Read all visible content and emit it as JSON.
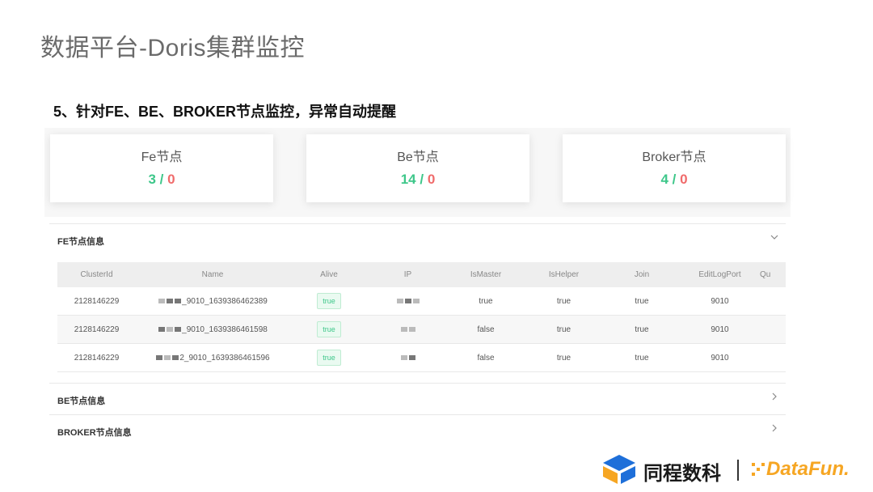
{
  "slide": {
    "title": "数据平台-Doris集群监控",
    "subtitle": "5、针对FE、BE、BROKER节点监控，异常自动提醒"
  },
  "stats": [
    {
      "title": "Fe节点",
      "ok": "3",
      "sep": " / ",
      "bad": "0"
    },
    {
      "title": "Be节点",
      "ok": "14",
      "sep": " / ",
      "bad": "0"
    },
    {
      "title": "Broker节点",
      "ok": "4",
      "sep": " / ",
      "bad": "0"
    }
  ],
  "sections": {
    "fe": "FE节点信息",
    "be": "BE节点信息",
    "broker": "BROKER节点信息"
  },
  "icons": {
    "expanded": "chevron-down-icon",
    "collapsed": "chevron-right-icon"
  },
  "fe_table": {
    "headers": [
      "ClusterId",
      "Name",
      "Alive",
      "IP",
      "IsMaster",
      "IsHelper",
      "Join",
      "EditLogPort",
      "Qu"
    ],
    "rows": [
      {
        "cluster": "2128146229",
        "name": "_9010_1639386462389",
        "alive": "true",
        "master": "true",
        "helper": "true",
        "join": "true",
        "port": "9010"
      },
      {
        "cluster": "2128146229",
        "name": "_9010_1639386461598",
        "alive": "true",
        "master": "false",
        "helper": "true",
        "join": "true",
        "port": "9010"
      },
      {
        "cluster": "2128146229",
        "name": "2_9010_1639386461596",
        "alive": "true",
        "master": "false",
        "helper": "true",
        "join": "true",
        "port": "9010"
      }
    ]
  },
  "branding": {
    "company": "同程数科",
    "partner": "DataFun.",
    "colors": {
      "primary_blue": "#1e6fd9",
      "partner_orange": "#f6a623",
      "ok_green": "#3ec78a",
      "bad_red": "#f06b6b"
    }
  }
}
